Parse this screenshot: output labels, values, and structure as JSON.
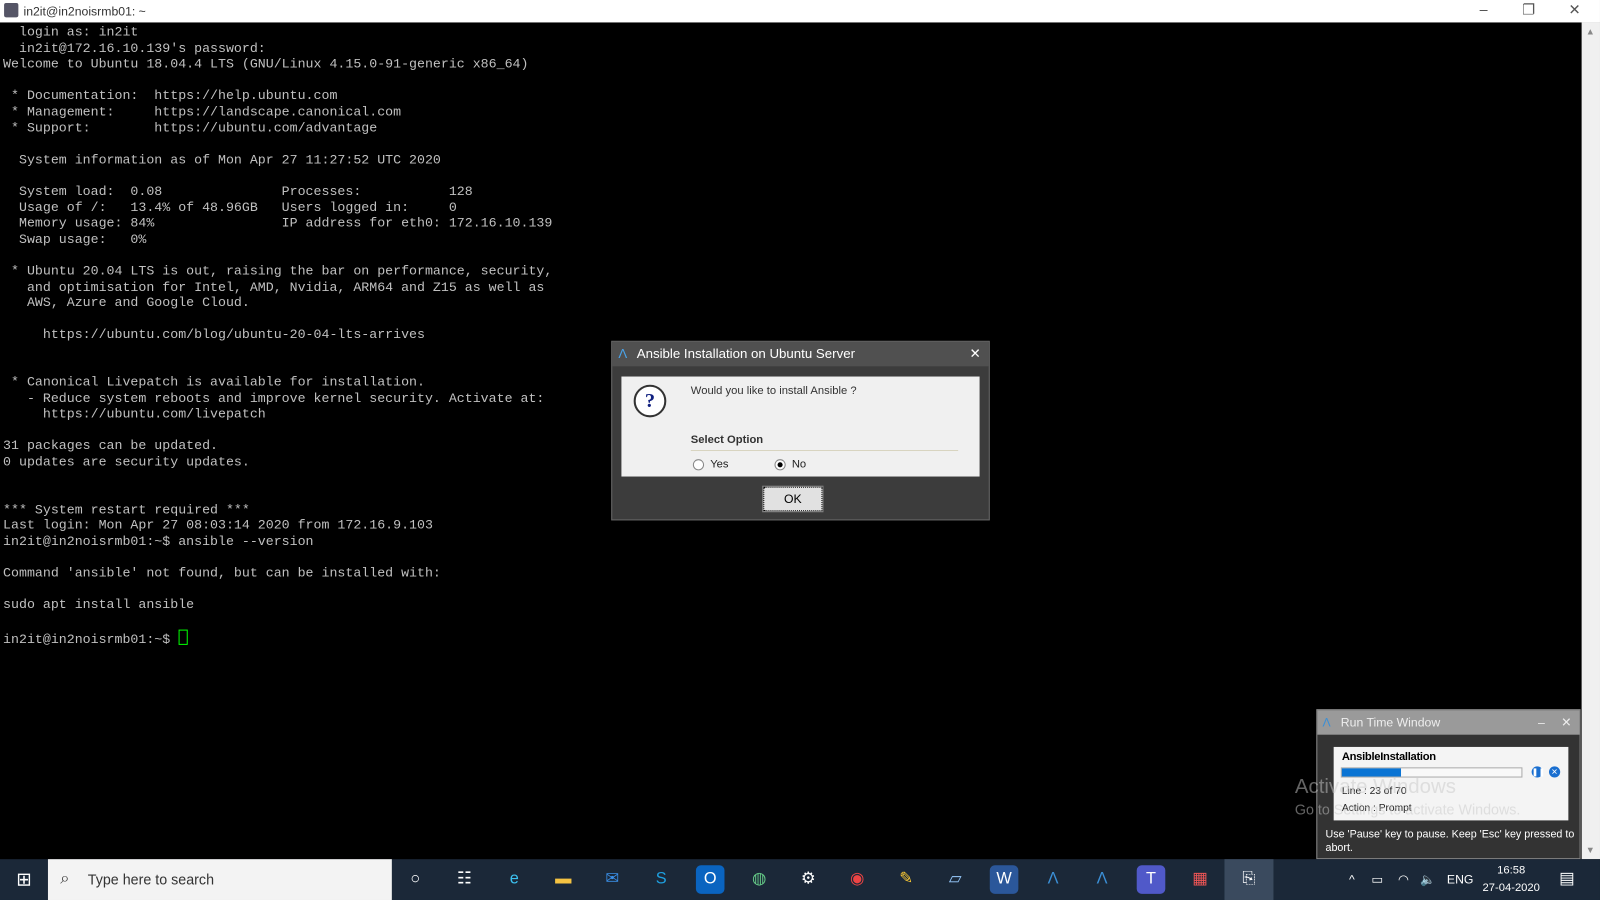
{
  "window": {
    "title": "in2it@in2noisrmb01: ~",
    "minimize": "–",
    "restore": "❐",
    "close": "✕"
  },
  "terminal": {
    "lines": [
      "  login as: in2it",
      "  in2it@172.16.10.139's password:",
      "Welcome to Ubuntu 18.04.4 LTS (GNU/Linux 4.15.0-91-generic x86_64)",
      "",
      " * Documentation:  https://help.ubuntu.com",
      " * Management:     https://landscape.canonical.com",
      " * Support:        https://ubuntu.com/advantage",
      "",
      "  System information as of Mon Apr 27 11:27:52 UTC 2020",
      "",
      "  System load:  0.08               Processes:           128",
      "  Usage of /:   13.4% of 48.96GB   Users logged in:     0",
      "  Memory usage: 84%                IP address for eth0: 172.16.10.139",
      "  Swap usage:   0%",
      "",
      " * Ubuntu 20.04 LTS is out, raising the bar on performance, security,",
      "   and optimisation for Intel, AMD, Nvidia, ARM64 and Z15 as well as",
      "   AWS, Azure and Google Cloud.",
      "",
      "     https://ubuntu.com/blog/ubuntu-20-04-lts-arrives",
      "",
      "",
      " * Canonical Livepatch is available for installation.",
      "   - Reduce system reboots and improve kernel security. Activate at:",
      "     https://ubuntu.com/livepatch",
      "",
      "31 packages can be updated.",
      "0 updates are security updates.",
      "",
      "",
      "*** System restart required ***",
      "Last login: Mon Apr 27 08:03:14 2020 from 172.16.9.103",
      "in2it@in2noisrmb01:~$ ansible --version",
      "",
      "Command 'ansible' not found, but can be installed with:",
      "",
      "sudo apt install ansible",
      ""
    ],
    "prompt": "in2it@in2noisrmb01:~$ "
  },
  "dialog": {
    "title": "Ansible Installation on Ubuntu Server",
    "close": "✕",
    "question": "Would you like to install Ansible ?",
    "select_label": "Select Option",
    "options": [
      "Yes",
      "No"
    ],
    "selected": "No",
    "ok": "OK",
    "icon": "question-icon"
  },
  "watermark": {
    "line1": "Activate Windows",
    "line2": "Go to Settings to activate Windows."
  },
  "runtime": {
    "title": "Run Time Window",
    "minimize": "–",
    "close": "✕",
    "name": "AnsibleInstallation",
    "progress": 0.33,
    "line": "Line : 23 of 70",
    "action": "Action : Prompt",
    "tip": "Use 'Pause' key to pause. Keep 'Esc' key pressed to abort."
  },
  "taskbar": {
    "search_placeholder": "Type here to search",
    "lang": "ENG",
    "time": "16:58",
    "date": "27-04-2020"
  }
}
